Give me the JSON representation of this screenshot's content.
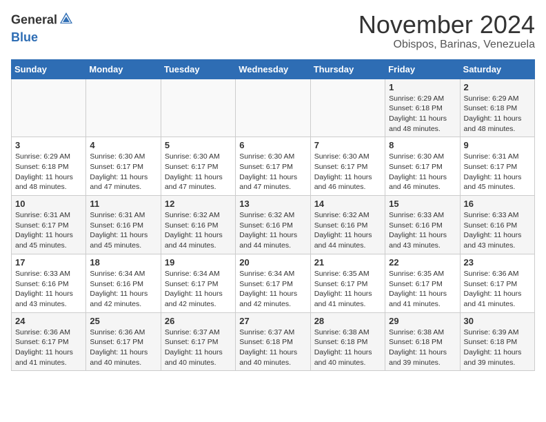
{
  "header": {
    "logo_line1": "General",
    "logo_line2": "Blue",
    "month_title": "November 2024",
    "location": "Obispos, Barinas, Venezuela"
  },
  "calendar": {
    "days_of_week": [
      "Sunday",
      "Monday",
      "Tuesday",
      "Wednesday",
      "Thursday",
      "Friday",
      "Saturday"
    ],
    "weeks": [
      [
        {
          "day": "",
          "info": ""
        },
        {
          "day": "",
          "info": ""
        },
        {
          "day": "",
          "info": ""
        },
        {
          "day": "",
          "info": ""
        },
        {
          "day": "",
          "info": ""
        },
        {
          "day": "1",
          "info": "Sunrise: 6:29 AM\nSunset: 6:18 PM\nDaylight: 11 hours and 48 minutes."
        },
        {
          "day": "2",
          "info": "Sunrise: 6:29 AM\nSunset: 6:18 PM\nDaylight: 11 hours and 48 minutes."
        }
      ],
      [
        {
          "day": "3",
          "info": "Sunrise: 6:29 AM\nSunset: 6:18 PM\nDaylight: 11 hours and 48 minutes."
        },
        {
          "day": "4",
          "info": "Sunrise: 6:30 AM\nSunset: 6:17 PM\nDaylight: 11 hours and 47 minutes."
        },
        {
          "day": "5",
          "info": "Sunrise: 6:30 AM\nSunset: 6:17 PM\nDaylight: 11 hours and 47 minutes."
        },
        {
          "day": "6",
          "info": "Sunrise: 6:30 AM\nSunset: 6:17 PM\nDaylight: 11 hours and 47 minutes."
        },
        {
          "day": "7",
          "info": "Sunrise: 6:30 AM\nSunset: 6:17 PM\nDaylight: 11 hours and 46 minutes."
        },
        {
          "day": "8",
          "info": "Sunrise: 6:30 AM\nSunset: 6:17 PM\nDaylight: 11 hours and 46 minutes."
        },
        {
          "day": "9",
          "info": "Sunrise: 6:31 AM\nSunset: 6:17 PM\nDaylight: 11 hours and 45 minutes."
        }
      ],
      [
        {
          "day": "10",
          "info": "Sunrise: 6:31 AM\nSunset: 6:17 PM\nDaylight: 11 hours and 45 minutes."
        },
        {
          "day": "11",
          "info": "Sunrise: 6:31 AM\nSunset: 6:16 PM\nDaylight: 11 hours and 45 minutes."
        },
        {
          "day": "12",
          "info": "Sunrise: 6:32 AM\nSunset: 6:16 PM\nDaylight: 11 hours and 44 minutes."
        },
        {
          "day": "13",
          "info": "Sunrise: 6:32 AM\nSunset: 6:16 PM\nDaylight: 11 hours and 44 minutes."
        },
        {
          "day": "14",
          "info": "Sunrise: 6:32 AM\nSunset: 6:16 PM\nDaylight: 11 hours and 44 minutes."
        },
        {
          "day": "15",
          "info": "Sunrise: 6:33 AM\nSunset: 6:16 PM\nDaylight: 11 hours and 43 minutes."
        },
        {
          "day": "16",
          "info": "Sunrise: 6:33 AM\nSunset: 6:16 PM\nDaylight: 11 hours and 43 minutes."
        }
      ],
      [
        {
          "day": "17",
          "info": "Sunrise: 6:33 AM\nSunset: 6:16 PM\nDaylight: 11 hours and 43 minutes."
        },
        {
          "day": "18",
          "info": "Sunrise: 6:34 AM\nSunset: 6:16 PM\nDaylight: 11 hours and 42 minutes."
        },
        {
          "day": "19",
          "info": "Sunrise: 6:34 AM\nSunset: 6:17 PM\nDaylight: 11 hours and 42 minutes."
        },
        {
          "day": "20",
          "info": "Sunrise: 6:34 AM\nSunset: 6:17 PM\nDaylight: 11 hours and 42 minutes."
        },
        {
          "day": "21",
          "info": "Sunrise: 6:35 AM\nSunset: 6:17 PM\nDaylight: 11 hours and 41 minutes."
        },
        {
          "day": "22",
          "info": "Sunrise: 6:35 AM\nSunset: 6:17 PM\nDaylight: 11 hours and 41 minutes."
        },
        {
          "day": "23",
          "info": "Sunrise: 6:36 AM\nSunset: 6:17 PM\nDaylight: 11 hours and 41 minutes."
        }
      ],
      [
        {
          "day": "24",
          "info": "Sunrise: 6:36 AM\nSunset: 6:17 PM\nDaylight: 11 hours and 41 minutes."
        },
        {
          "day": "25",
          "info": "Sunrise: 6:36 AM\nSunset: 6:17 PM\nDaylight: 11 hours and 40 minutes."
        },
        {
          "day": "26",
          "info": "Sunrise: 6:37 AM\nSunset: 6:17 PM\nDaylight: 11 hours and 40 minutes."
        },
        {
          "day": "27",
          "info": "Sunrise: 6:37 AM\nSunset: 6:18 PM\nDaylight: 11 hours and 40 minutes."
        },
        {
          "day": "28",
          "info": "Sunrise: 6:38 AM\nSunset: 6:18 PM\nDaylight: 11 hours and 40 minutes."
        },
        {
          "day": "29",
          "info": "Sunrise: 6:38 AM\nSunset: 6:18 PM\nDaylight: 11 hours and 39 minutes."
        },
        {
          "day": "30",
          "info": "Sunrise: 6:39 AM\nSunset: 6:18 PM\nDaylight: 11 hours and 39 minutes."
        }
      ]
    ]
  }
}
